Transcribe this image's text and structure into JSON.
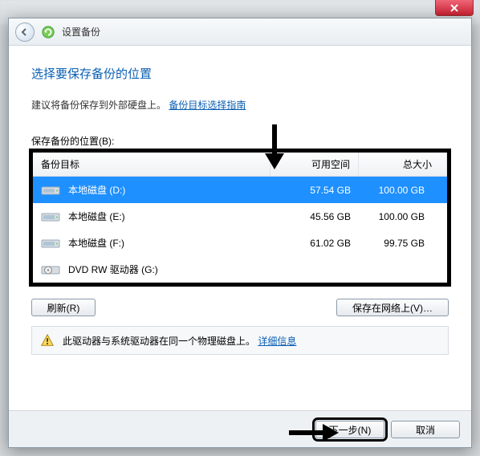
{
  "window": {
    "title": "设置备份"
  },
  "page": {
    "heading": "选择要保存备份的位置",
    "instruction": "建议将备份保存到外部硬盘上。",
    "guide_link": "备份目标选择指南",
    "location_label": "保存备份的位置(B):"
  },
  "table": {
    "headers": {
      "target": "备份目标",
      "free": "可用空间",
      "total": "总大小"
    },
    "rows": [
      {
        "icon": "hdd-icon",
        "name": "本地磁盘 (D:)",
        "free": "57.54 GB",
        "total": "100.00 GB",
        "selected": true
      },
      {
        "icon": "hdd-icon",
        "name": "本地磁盘 (E:)",
        "free": "45.56 GB",
        "total": "100.00 GB",
        "selected": false
      },
      {
        "icon": "hdd-icon",
        "name": "本地磁盘 (F:)",
        "free": "61.02 GB",
        "total": "99.75 GB",
        "selected": false
      },
      {
        "icon": "dvd-icon",
        "name": "DVD RW 驱动器 (G:)",
        "free": "",
        "total": "",
        "selected": false
      }
    ]
  },
  "buttons": {
    "refresh": "刷新(R)",
    "save_network": "保存在网络上(V)…",
    "next": "下一步(N)",
    "cancel": "取消"
  },
  "warning": {
    "text": "此驱动器与系统驱动器在同一个物理磁盘上。",
    "link": "详细信息"
  }
}
